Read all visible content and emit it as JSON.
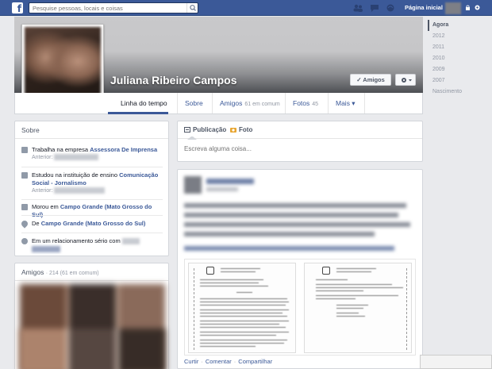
{
  "topbar": {
    "logo": "f",
    "search_placeholder": "Pesquise pessoas, locais e coisas",
    "home_label": "Página inicial"
  },
  "profile": {
    "name": "Juliana Ribeiro Campos",
    "friends_button": "✓ Amigos",
    "settings_button": "⚙ ▾"
  },
  "tabs": {
    "timeline": "Linha do tempo",
    "about": "Sobre",
    "friends": "Amigos",
    "friends_count": "61 em comum",
    "photos": "Fotos",
    "photos_count": "45",
    "more": "Mais ▾"
  },
  "years": [
    "Agora",
    "2012",
    "2011",
    "2010",
    "2009",
    "2007",
    "Nascimento"
  ],
  "about": {
    "title": "Sobre",
    "work_prefix": "Trabalha na empresa",
    "work_company": "Assessora De Imprensa",
    "work_previous": "Anterior:",
    "study_prefix": "Estudou na instituição de ensino",
    "study_school": "Comunicação Social - Jornalismo",
    "study_previous": "Anterior:",
    "lived_prefix": "Morou em",
    "lived_city": "Campo Grande (Mato Grosso do Sul)",
    "from_prefix": "De",
    "from_city": "Campo Grande (Mato Grosso do Sul)",
    "relationship": "Em um relacionamento sério com"
  },
  "friends_card": {
    "title": "Amigos",
    "count": "· 214 (61 em comum)"
  },
  "composer": {
    "status_tab": "Publicação",
    "photo_tab": "Foto",
    "placeholder": "Escreva alguma coisa..."
  },
  "post": {
    "like": "Curtir",
    "comment": "Comentar",
    "share": "Compartilhar"
  },
  "colors": {
    "topbar": "#3b5998",
    "link": "#3b5998",
    "page_bg": "#e9eaed"
  }
}
